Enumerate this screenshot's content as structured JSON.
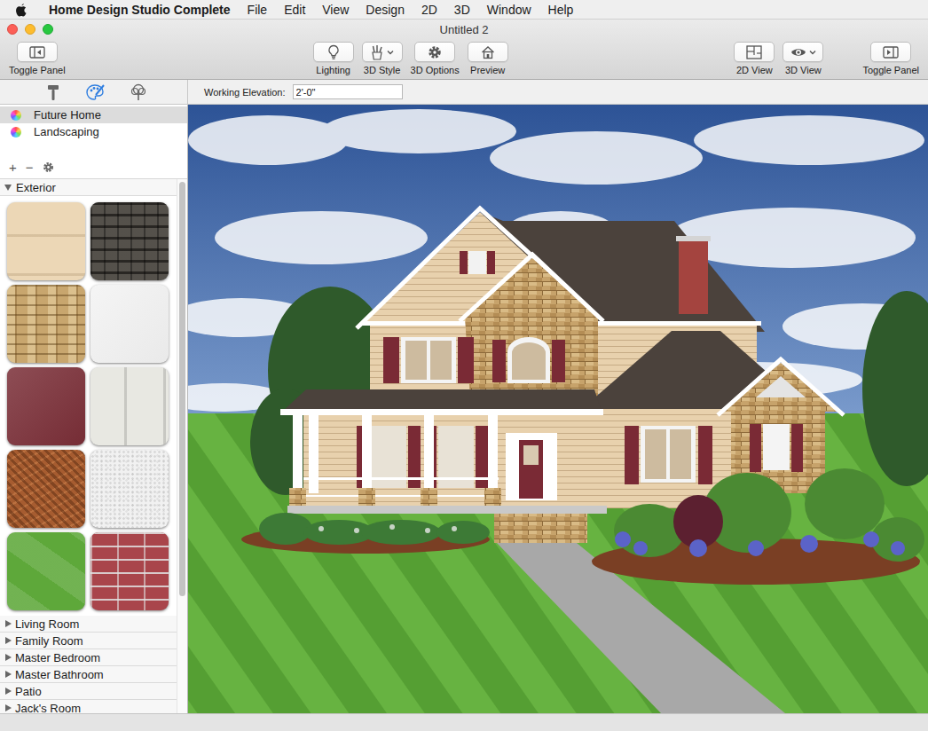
{
  "menubar": {
    "app": "Home Design Studio Complete",
    "menus": [
      "File",
      "Edit",
      "View",
      "Design",
      "2D",
      "3D",
      "Window",
      "Help"
    ]
  },
  "window": {
    "title": "Untitled 2"
  },
  "toolbar": {
    "left": [
      {
        "label": "Toggle Panel",
        "kind": "panel-left",
        "dropdown": false
      }
    ],
    "center": [
      {
        "label": "Lighting",
        "kind": "bulb",
        "dropdown": false
      },
      {
        "label": "3D Style",
        "kind": "style",
        "dropdown": true
      },
      {
        "label": "3D Options",
        "kind": "gear",
        "dropdown": false
      },
      {
        "label": "Preview",
        "kind": "house",
        "dropdown": false
      }
    ],
    "right": [
      {
        "label": "2D View",
        "kind": "plan",
        "dropdown": false
      },
      {
        "label": "3D View",
        "kind": "eye",
        "dropdown": true
      }
    ],
    "far_right": [
      {
        "label": "Toggle Panel",
        "kind": "panel-right",
        "dropdown": false
      }
    ]
  },
  "panel_tabs": [
    {
      "kind": "hammer",
      "selected": false
    },
    {
      "kind": "palette",
      "selected": true
    },
    {
      "kind": "tree",
      "selected": false
    }
  ],
  "elevation": {
    "label": "Working Elevation:",
    "value": "2'-0\""
  },
  "catalogs": [
    {
      "label": "Future Home",
      "selected": true
    },
    {
      "label": "Landscaping",
      "selected": false
    }
  ],
  "catalog_actions": {
    "add": "+",
    "remove": "−"
  },
  "sections": [
    {
      "label": "Exterior",
      "expanded": true,
      "swatches": [
        {
          "kind": "siding",
          "color": "#ecd7b6"
        },
        {
          "kind": "shingle",
          "color": "#4a4640"
        },
        {
          "kind": "stone",
          "color": "#c8a66e"
        },
        {
          "kind": "plain",
          "color": "#f3f3f3"
        },
        {
          "kind": "plain",
          "color": "#7a2e37"
        },
        {
          "kind": "vinyl",
          "color": "#e8e8e2"
        },
        {
          "kind": "mulch",
          "color": "#a65c30"
        },
        {
          "kind": "stucco",
          "color": "#f1f1f1"
        },
        {
          "kind": "grass",
          "color": "#5ea83a"
        },
        {
          "kind": "brick",
          "color": "#a9454b"
        }
      ]
    },
    {
      "label": "Living Room",
      "expanded": false,
      "swatches": []
    },
    {
      "label": "Family Room",
      "expanded": false,
      "swatches": []
    },
    {
      "label": "Master Bedroom",
      "expanded": false,
      "swatches": []
    },
    {
      "label": "Master Bathroom",
      "expanded": false,
      "swatches": []
    },
    {
      "label": "Patio",
      "expanded": false,
      "swatches": []
    },
    {
      "label": "Jack's Room",
      "expanded": false,
      "swatches": []
    }
  ],
  "sidebar_scroll": {
    "level": 0.78
  }
}
